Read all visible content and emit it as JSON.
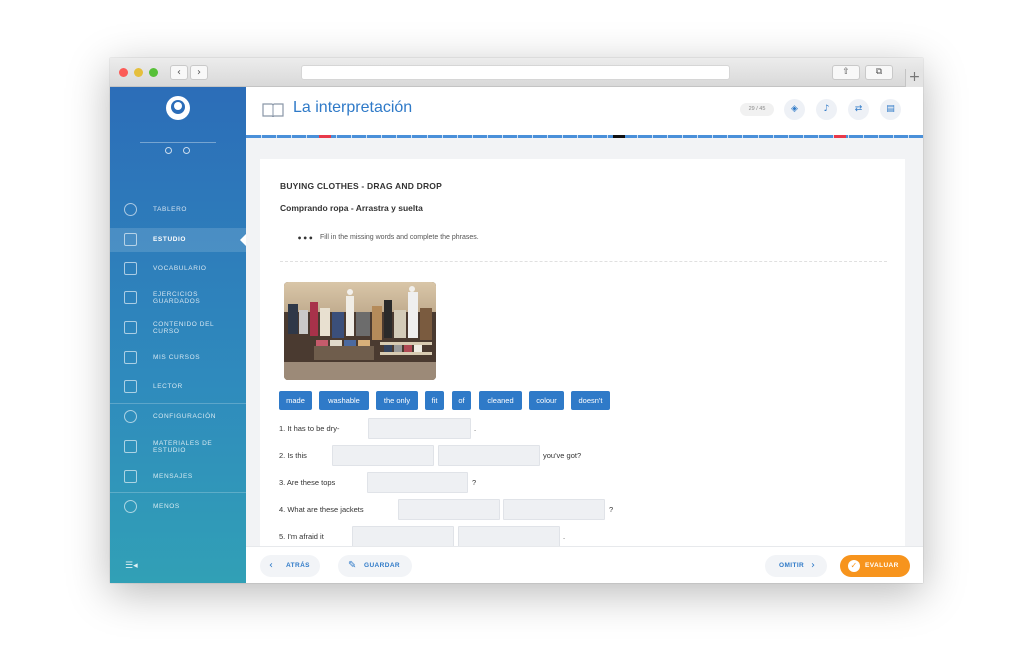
{
  "browser": {
    "back_glyph": "‹",
    "forward_glyph": "›",
    "share_glyph": "⇧",
    "tabs_glyph": "⧉",
    "new_tab_glyph": "+"
  },
  "sidebar": {
    "items": [
      {
        "label": "TABLERO",
        "icon": "dashboard-icon"
      },
      {
        "label": "ESTUDIO",
        "icon": "book-icon",
        "active": true
      },
      {
        "label": "VOCABULARIO",
        "icon": "vocabulary-icon"
      },
      {
        "label": "EJERCICIOS GUARDADOS",
        "icon": "saved-exercises-icon"
      },
      {
        "label": "CONTENIDO DEL CURSO",
        "icon": "course-content-icon"
      },
      {
        "label": "MIS CURSOS",
        "icon": "my-courses-icon"
      },
      {
        "label": "LECTOR",
        "icon": "reader-icon"
      },
      {
        "label": "CONFIGURACIÓN",
        "icon": "gear-icon"
      },
      {
        "label": "MATERIALES DE ESTUDIO",
        "icon": "materials-icon"
      },
      {
        "label": "MENSAJES",
        "icon": "mail-icon"
      },
      {
        "label": "MENOS",
        "icon": "minus-icon"
      }
    ],
    "collapse_glyph": "☰◂"
  },
  "header": {
    "title": "La interpretación",
    "counter": "29 / 45"
  },
  "progress": {
    "current_fraction": 0.542
  },
  "exercise": {
    "title": "BUYING CLOTHES - DRAG AND DROP",
    "subtitle": "Comprando ropa - Arrastra y suelta",
    "instruction_bullet": "•••",
    "instruction": "Fill in the missing words and complete the phrases.",
    "words": [
      "made",
      "washable",
      "the only",
      "fit",
      "of",
      "cleaned",
      "colour",
      "doesn't"
    ],
    "questions": [
      {
        "prefix": "1. It has to be dry-",
        "suffix": "."
      },
      {
        "prefix": "2. Is this",
        "suffix": "you've got?"
      },
      {
        "prefix": "3. Are these tops",
        "suffix": "?"
      },
      {
        "prefix": "4. What are these jackets",
        "suffix": "?"
      },
      {
        "prefix": "5. I'm afraid it",
        "suffix": "."
      }
    ]
  },
  "footer": {
    "back_label": "ATRÁS",
    "save_label": "GUARDAR",
    "skip_label": "OMITIR",
    "evaluate_label": "EVALUAR"
  },
  "colors": {
    "accent": "#2f7ac8",
    "evaluate": "#f7941d",
    "progress_marker_red": "#e8394a",
    "progress_marker_current": "#111111"
  }
}
